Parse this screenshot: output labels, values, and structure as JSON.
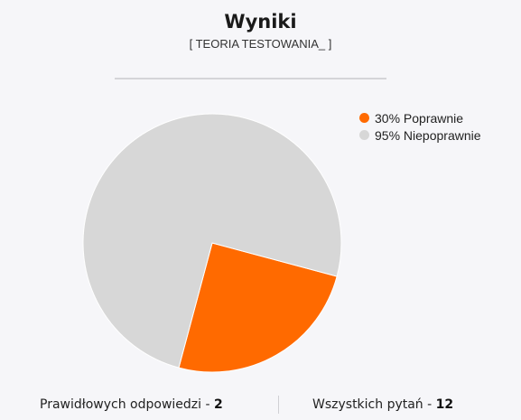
{
  "header": {
    "title": "Wyniki",
    "subtitle": "[ TEORIA TESTOWANIA_ ]"
  },
  "chart_data": {
    "type": "pie",
    "slices": [
      {
        "label": "30% Poprawnie",
        "value": 25,
        "color": "#ff6a00"
      },
      {
        "label": "95% Niepoprawnie",
        "value": 75,
        "color": "#d7d7d7"
      }
    ],
    "legend_position": "top-right"
  },
  "footer": {
    "correct_label": "Prawidłowych odpowiedzi - ",
    "correct_value": "2",
    "total_label": "Wszystkich pytań - ",
    "total_value": "12"
  }
}
